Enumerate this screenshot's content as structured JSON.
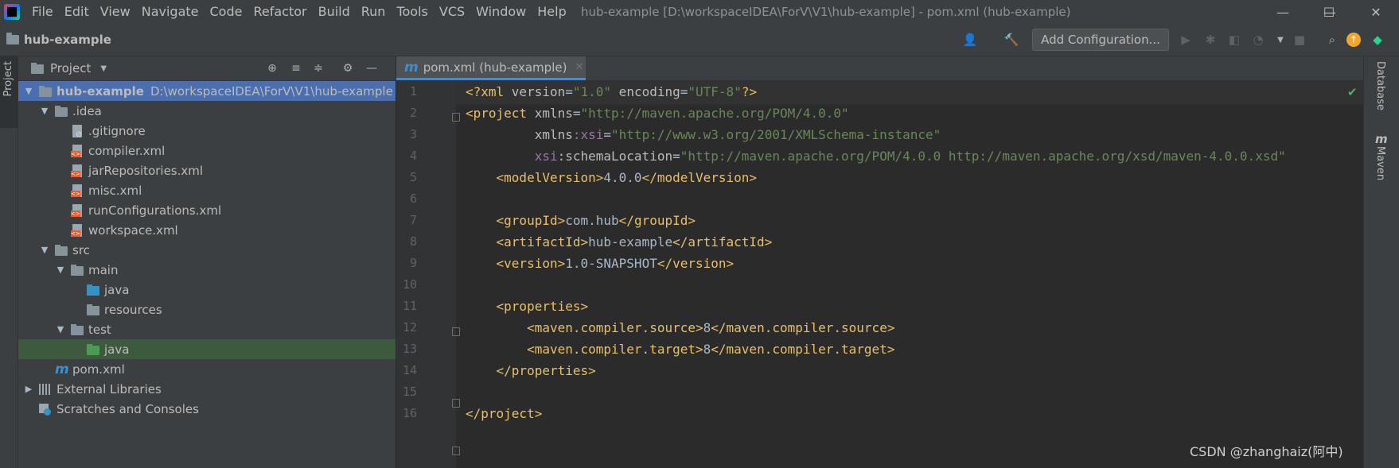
{
  "window": {
    "menu": [
      "File",
      "Edit",
      "View",
      "Navigate",
      "Code",
      "Refactor",
      "Build",
      "Run",
      "Tools",
      "VCS",
      "Window",
      "Help"
    ],
    "title": "hub-example [D:\\workspaceIDEA\\ForV\\V1\\hub-example] - pom.xml (hub-example)",
    "minimize": "—",
    "maximize": "☐",
    "close": "✕"
  },
  "toolbar": {
    "project_name": "hub-example",
    "add_configuration": "Add Configuration..."
  },
  "left_strip": {
    "project_label": "Project"
  },
  "right_strip": {
    "database_label": "Database",
    "maven_label": "Maven"
  },
  "project_panel": {
    "title": "Project",
    "tree": [
      {
        "label": "hub-example",
        "suffix": "D:\\workspaceIDEA\\ForV\\V1\\hub-example"
      },
      {
        "label": ".idea"
      },
      {
        "label": ".gitignore"
      },
      {
        "label": "compiler.xml"
      },
      {
        "label": "jarRepositories.xml"
      },
      {
        "label": "misc.xml"
      },
      {
        "label": "runConfigurations.xml"
      },
      {
        "label": "workspace.xml"
      },
      {
        "label": "src"
      },
      {
        "label": "main"
      },
      {
        "label": "java"
      },
      {
        "label": "resources"
      },
      {
        "label": "test"
      },
      {
        "label": "java"
      },
      {
        "label": "pom.xml"
      },
      {
        "label": "External Libraries"
      },
      {
        "label": "Scratches and Consoles"
      }
    ]
  },
  "editor": {
    "tab_label": "pom.xml (hub-example)",
    "line_numbers": [
      "1",
      "2",
      "3",
      "4",
      "5",
      "6",
      "7",
      "8",
      "9",
      "10",
      "11",
      "12",
      "13",
      "14",
      "15",
      "16"
    ],
    "lines": {
      "l1_a": "<?xml ",
      "l1_b": "version",
      "l1_c": "=",
      "l1_d": "\"1.0\"",
      "l1_e": " encoding",
      "l1_f": "=",
      "l1_g": "\"UTF-8\"",
      "l1_h": "?>",
      "l2_a": "<project ",
      "l2_b": "xmlns",
      "l2_c": "=",
      "l2_d": "\"http://maven.apache.org/POM/4.0.0\"",
      "l3_a": "         xmlns",
      "l3_b": ":xsi",
      "l3_c": "=",
      "l3_d": "\"http://www.w3.org/2001/XMLSchema-instance\"",
      "l4_a": "         xsi",
      "l4_b": ":schemaLocation",
      "l4_c": "=",
      "l4_d": "\"http://maven.apache.org/POM/4.0.0 http://maven.apache.org/xsd/maven-4.0.0.xsd\"",
      "l5_a": "    <modelVersion>",
      "l5_b": "4.0.0",
      "l5_c": "</modelVersion>",
      "l7_a": "    <groupId>",
      "l7_b": "com.hub",
      "l7_c": "</groupId>",
      "l8_a": "    <artifactId>",
      "l8_b": "hub-example",
      "l8_c": "</artifactId>",
      "l9_a": "    <version>",
      "l9_b": "1.0-SNAPSHOT",
      "l9_c": "</version>",
      "l11": "    <properties>",
      "l12_a": "        <maven.compiler.source>",
      "l12_b": "8",
      "l12_c": "</maven.compiler.source>",
      "l13_a": "        <maven.compiler.target>",
      "l13_b": "8",
      "l13_c": "</maven.compiler.target>",
      "l14": "    </properties>",
      "l16": "</project>"
    }
  },
  "watermark": "CSDN @zhanghaiz(阿中)",
  "colors": {
    "accent": "#4b6eaf",
    "tag": "#e8bf6a",
    "value": "#6a8759",
    "namespace": "#9876aa"
  }
}
